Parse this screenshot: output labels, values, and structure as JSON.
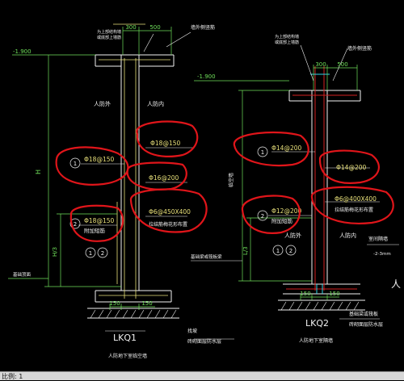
{
  "drawing": {
    "colors": {
      "background": "#000000",
      "structure": "#f2f2f2",
      "dimension": "#6fe05a",
      "rebar": "#e8e07a",
      "annotation": "#e0151a",
      "section_red": "#d42020",
      "cyan": "#2fd6e6"
    },
    "left": {
      "top_note_1": "为上部结构墙",
      "top_note_2": "或底部上墙筋",
      "outer_layer": "墙外侧竖筋",
      "dim_300": "300",
      "dim_500": "500",
      "level": "-1.900",
      "side_outer": "人防外",
      "side_inner": "人防内",
      "h_label": "H",
      "h3_label": "H/3",
      "r_top": "Φ18@150",
      "r_left": "Φ18@150",
      "r_mid": "Φ16@200",
      "r_tie": "Φ6@450X400",
      "r_tie_note": "拉结筋梅花形布置",
      "r_add": "Φ18@150",
      "r_add_note": "附加短筋",
      "circle_1": "1",
      "circle_2": "2",
      "slab_note": "基础顶面",
      "dim_150a": "150",
      "dim_150b": "150",
      "label": "LKQ1",
      "subtitle": "人防地下室临空墙",
      "bottom_note_1": "找坡",
      "bottom_note_2": "砖砌面层防水层"
    },
    "right": {
      "top_note_1": "为上部结构墙",
      "top_note_2": "或底部上墙筋",
      "outer_layer": "墙外侧竖筋",
      "dim_300": "300",
      "dim_500": "500",
      "level": "-1.900",
      "side_label": "临空墙",
      "l3_label": "L/3",
      "r_left": "Φ14@200",
      "r_right": "Φ14@200",
      "r_tie": "Φ6@400X400",
      "r_tie_note": "拉结筋梅花形布置",
      "r_add": "Φ12@200",
      "r_add_note": "附加短筋",
      "side_outer": "人防外",
      "side_inner": "人防内",
      "circle_1": "1",
      "circle_2": "2",
      "slab_note": "基础梁或筏板梁",
      "dim_150a": "150",
      "dim_150b": "150",
      "label": "LKQ2",
      "subtitle": "人防地下室隔墙",
      "bottom_note_1": "基础梁或筏板",
      "bottom_note_2": "砖砌面层防水层",
      "edge_note_1": "室间隔墙",
      "edge_note_2": "-2-3mm",
      "edge_char": "人"
    }
  },
  "statusbar": {
    "scale_label": "比例:",
    "scale_value": "1"
  }
}
